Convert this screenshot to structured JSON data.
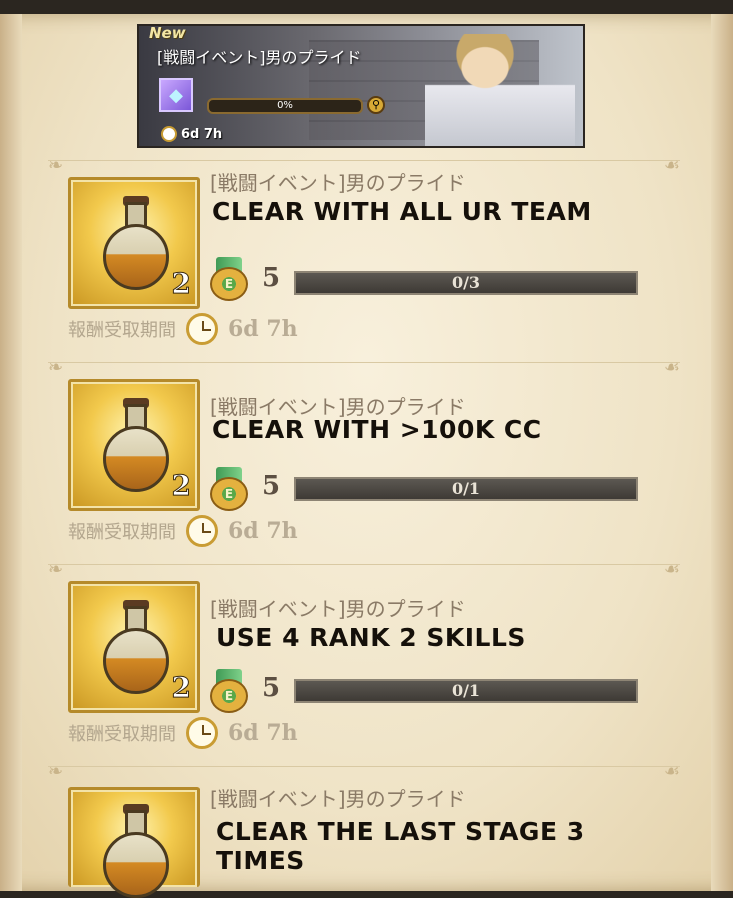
{
  "banner": {
    "new_label": "New",
    "title": "[戦闘イベント]男のプライド",
    "progress": "0%",
    "timer": "6d 7h"
  },
  "missions": [
    {
      "event": "[戦闘イベント]男のプライド",
      "title": "Clear with all UR team",
      "reward_qty": "2",
      "points": "5",
      "progress": "0/3",
      "period_label": "報酬受取期間",
      "period_time": "6d 7h"
    },
    {
      "event": "[戦闘イベント]男のプライド",
      "title": "Clear with >100k CC",
      "reward_qty": "2",
      "points": "5",
      "progress": "0/1",
      "period_label": "報酬受取期間",
      "period_time": "6d 7h"
    },
    {
      "event": "[戦闘イベント]男のプライド",
      "title": "Use 4 rank 2 skills",
      "reward_qty": "2",
      "points": "5",
      "progress": "0/1",
      "period_label": "報酬受取期間",
      "period_time": "6d 7h"
    },
    {
      "event": "[戦闘イベント]男のプライド",
      "title": "Clear the last stage 3 times"
    }
  ]
}
